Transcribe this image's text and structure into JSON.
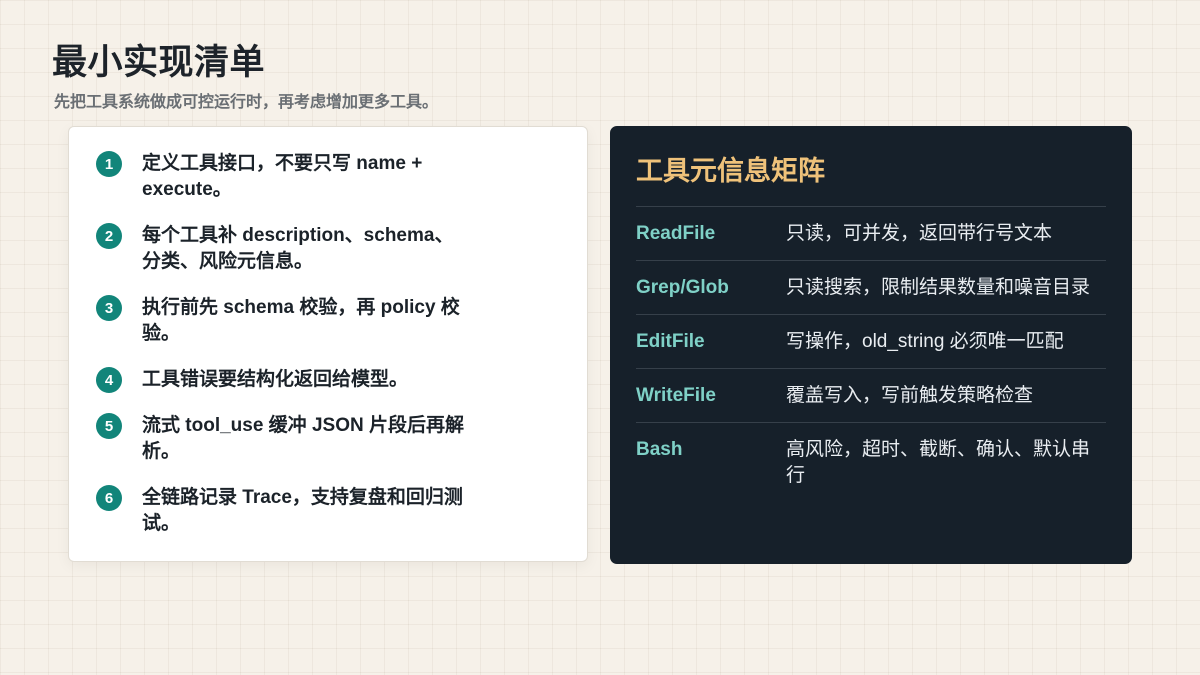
{
  "header": {
    "title": "最小实现清单",
    "subtitle": "先把工具系统做成可控运行时，再考虑增加更多工具。"
  },
  "checklist": {
    "items": [
      {
        "num": "1",
        "text": "定义工具接口，不要只写 name + execute。"
      },
      {
        "num": "2",
        "text": "每个工具补 description、schema、分类、风险元信息。"
      },
      {
        "num": "3",
        "text": "执行前先 schema 校验，再 policy 校验。"
      },
      {
        "num": "4",
        "text": "工具错误要结构化返回给模型。"
      },
      {
        "num": "5",
        "text": "流式 tool_use 缓冲 JSON 片段后再解析。"
      },
      {
        "num": "6",
        "text": "全链路记录 Trace，支持复盘和回归测试。"
      }
    ]
  },
  "matrix": {
    "title": "工具元信息矩阵",
    "rows": [
      {
        "name": "ReadFile",
        "desc": "只读，可并发，返回带行号文本"
      },
      {
        "name": "Grep/Glob",
        "desc": "只读搜索，限制结果数量和噪音目录"
      },
      {
        "name": "EditFile",
        "desc": "写操作，old_string 必须唯一匹配"
      },
      {
        "name": "WriteFile",
        "desc": "覆盖写入，写前触发策略检查"
      },
      {
        "name": "Bash",
        "desc": "高风险，超时、截断、确认、默认串行"
      }
    ]
  },
  "colors": {
    "background": "#f6f1e9",
    "accent_teal": "#12857a",
    "matrix_bg": "#16202a",
    "matrix_title": "#efc27a",
    "tool_name": "#7fd1c7"
  }
}
